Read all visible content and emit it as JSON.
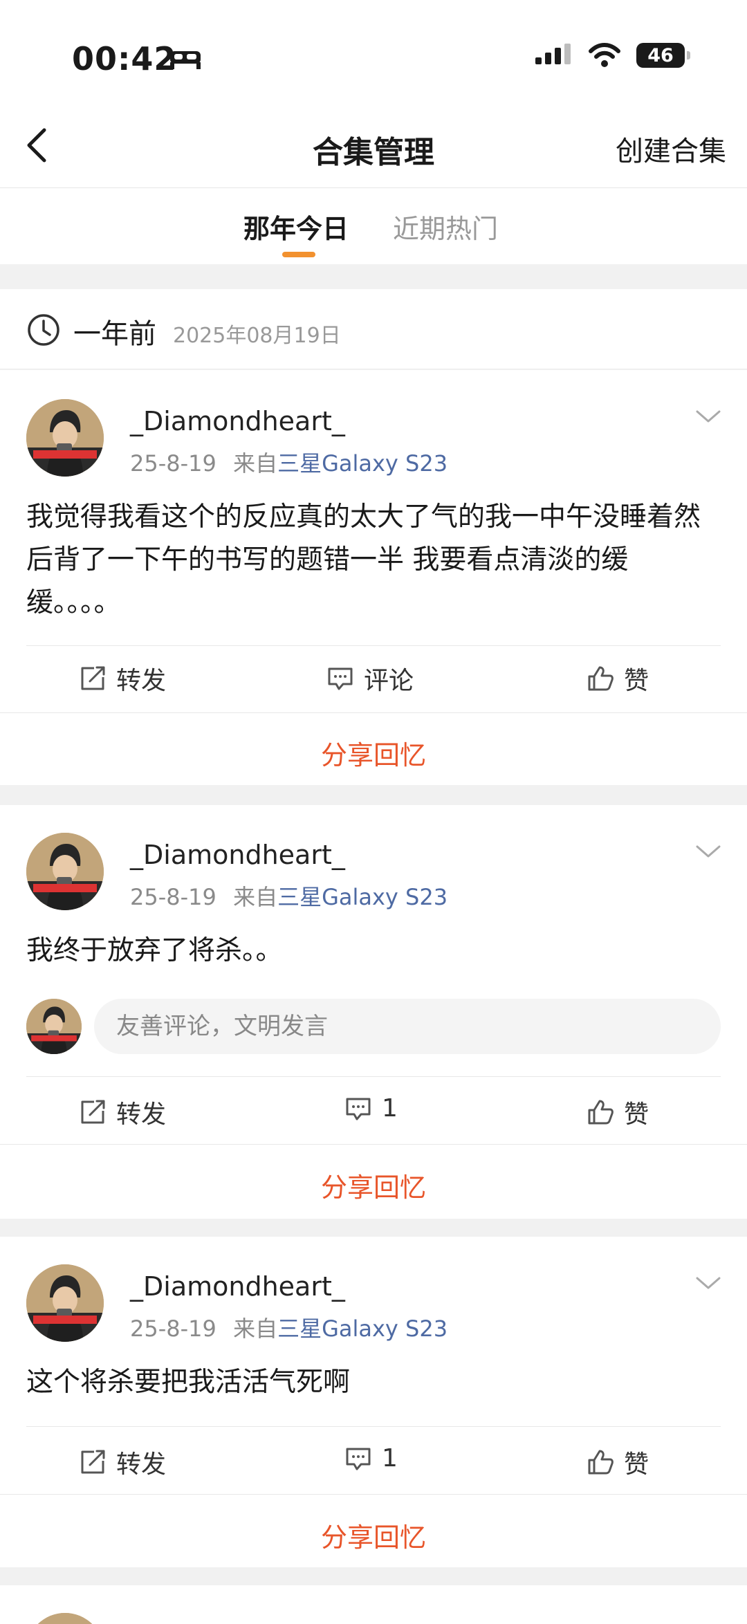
{
  "status_bar": {
    "time": "00:42",
    "battery": "46"
  },
  "nav": {
    "title": "合集管理",
    "create_label": "创建合集"
  },
  "tabs": [
    {
      "label": "那年今日",
      "active": true
    },
    {
      "label": "近期热门",
      "active": false
    }
  ],
  "section": {
    "label": "一年前",
    "date": "2025年08月19日"
  },
  "posts": [
    {
      "username": "_Diamondheart_",
      "date": "25-8-19",
      "from_label": "来自",
      "source": "三星Galaxy S23",
      "text": "我觉得我看这个的反应真的太大了气的我一中午没睡着然后背了一下午的书写的题错一半 我要看点清淡的缓缓。。。。",
      "repost_label": "转发",
      "comment_label": "评论",
      "like_label": "赞",
      "share_label": "分享回忆"
    },
    {
      "username": "_Diamondheart_",
      "date": "25-8-19",
      "from_label": "来自",
      "source": "三星Galaxy S23",
      "text": "我终于放弃了将杀。。",
      "comment_placeholder": "友善评论，文明发言",
      "repost_label": "转发",
      "comment_label": "1",
      "like_label": "赞",
      "share_label": "分享回忆"
    },
    {
      "username": "_Diamondheart_",
      "date": "25-8-19",
      "from_label": "来自",
      "source": "三星Galaxy S23",
      "text": "这个将杀要把我活活气死啊",
      "repost_label": "转发",
      "comment_label": "1",
      "like_label": "赞",
      "share_label": "分享回忆"
    }
  ],
  "colors": {
    "accent": "#e8552a",
    "tab_indicator": "#f2912f",
    "source_link": "#4e6aa3"
  }
}
